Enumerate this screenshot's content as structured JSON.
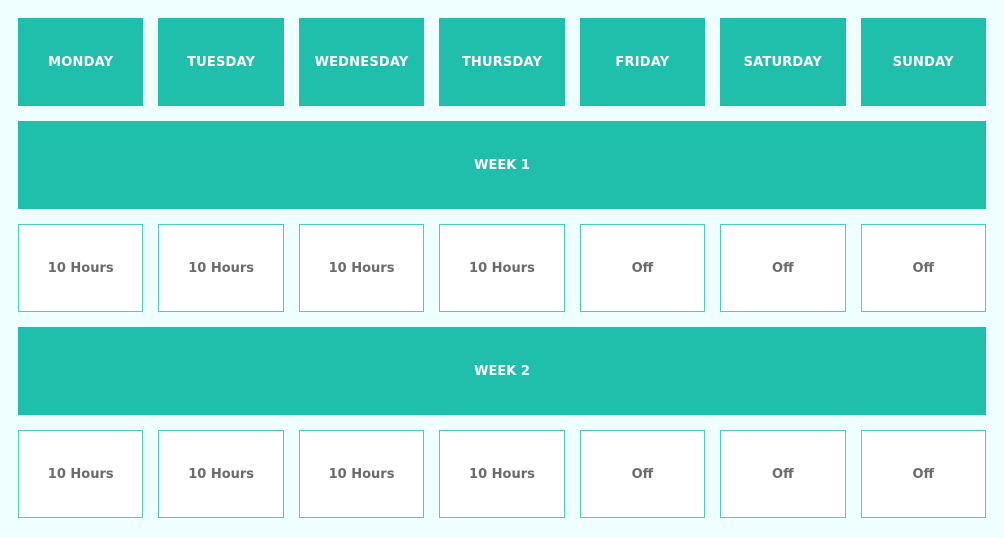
{
  "days": [
    "MONDAY",
    "TUESDAY",
    "WEDNESDAY",
    "THURSDAY",
    "FRIDAY",
    "SATURDAY",
    "SUNDAY"
  ],
  "weeks": [
    {
      "label": "WEEK 1",
      "values": [
        "10 Hours",
        "10 Hours",
        "10 Hours",
        "10 Hours",
        "Off",
        "Off",
        "Off"
      ]
    },
    {
      "label": "WEEK 2",
      "values": [
        "10 Hours",
        "10 Hours",
        "10 Hours",
        "10 Hours",
        "Off",
        "Off",
        "Off"
      ]
    }
  ],
  "colors": {
    "accent": "#20bfac",
    "background": "#effefe",
    "cell_border": "#4ccdbd",
    "cell_text": "#6b6b6b"
  }
}
